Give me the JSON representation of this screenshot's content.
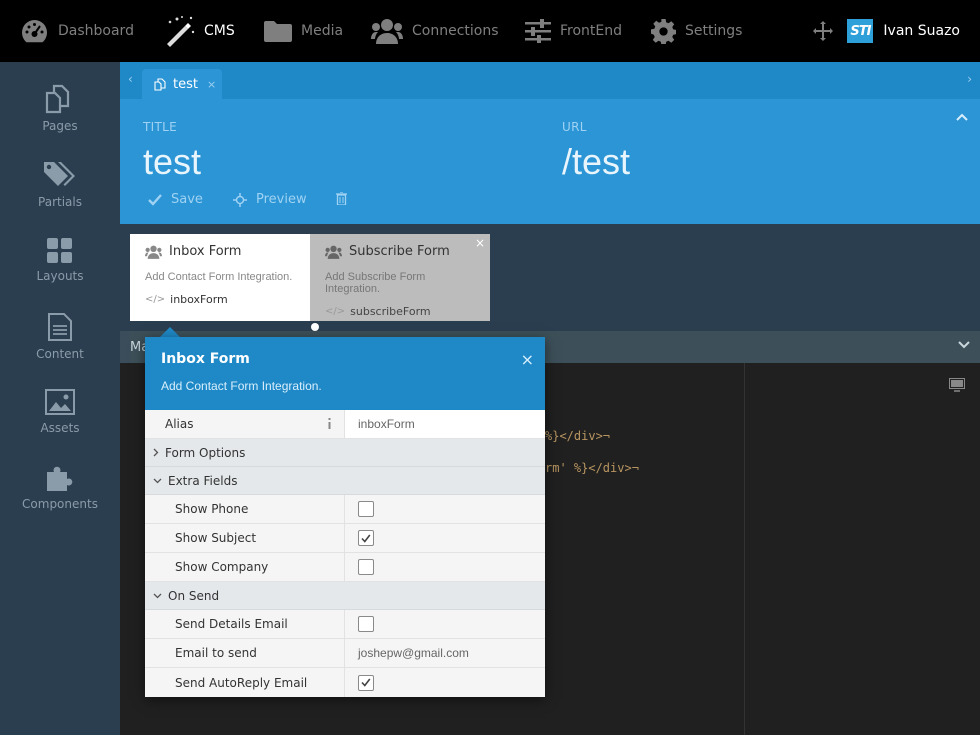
{
  "nav": {
    "items": [
      {
        "label": "Dashboard",
        "icon": "dashboard-icon"
      },
      {
        "label": "CMS",
        "icon": "magic-wand-icon"
      },
      {
        "label": "Media",
        "icon": "folder-icon"
      },
      {
        "label": "Connections",
        "icon": "users-icon"
      },
      {
        "label": "FrontEnd",
        "icon": "sliders-icon"
      },
      {
        "label": "Settings",
        "icon": "gear-icon"
      }
    ],
    "user_logo": "STI",
    "user_name": "Ivan Suazo"
  },
  "sidebar": {
    "items": [
      {
        "label": "Pages",
        "icon": "pages-icon"
      },
      {
        "label": "Partials",
        "icon": "tags-icon"
      },
      {
        "label": "Layouts",
        "icon": "layouts-icon"
      },
      {
        "label": "Content",
        "icon": "content-icon"
      },
      {
        "label": "Assets",
        "icon": "image-icon"
      },
      {
        "label": "Components",
        "icon": "puzzle-icon"
      }
    ]
  },
  "tabs": {
    "active": {
      "label": "test",
      "close": "×"
    }
  },
  "form": {
    "title_label": "TITLE",
    "title_value": "test",
    "url_label": "URL",
    "url_value": "/test",
    "save_label": "Save",
    "preview_label": "Preview"
  },
  "components": [
    {
      "name": "Inbox Form",
      "desc": "Add Contact Form Integration.",
      "alias": "inboxForm"
    },
    {
      "name": "Subscribe Form",
      "desc": "Add Subscribe Form Integration.",
      "alias": "subscribeForm",
      "close": "×"
    }
  ],
  "secondary_bar": {
    "label": "Ma"
  },
  "code": {
    "line1": "%}</div>¬",
    "line2": "rm' %}</div>¬"
  },
  "popup": {
    "title": "Inbox Form",
    "description": "Add Contact Form Integration.",
    "close": "×",
    "alias_label": "Alias",
    "alias_value": "inboxForm",
    "group_form_options": "Form Options",
    "group_extra_fields": "Extra Fields",
    "show_phone_label": "Show Phone",
    "show_phone_checked": false,
    "show_subject_label": "Show Subject",
    "show_subject_checked": true,
    "show_company_label": "Show Company",
    "show_company_checked": false,
    "group_on_send": "On Send",
    "send_details_label": "Send Details Email",
    "send_details_checked": false,
    "email_to_send_label": "Email to send",
    "email_to_send_value": "joshepw@gmail.com",
    "send_autoreply_label": "Send AutoReply Email",
    "send_autoreply_checked": true
  },
  "colors": {
    "topbar": "#000000",
    "sidebar": "#2b3e50",
    "accent": "#2c95d6",
    "popup_header": "#1f89c7"
  }
}
